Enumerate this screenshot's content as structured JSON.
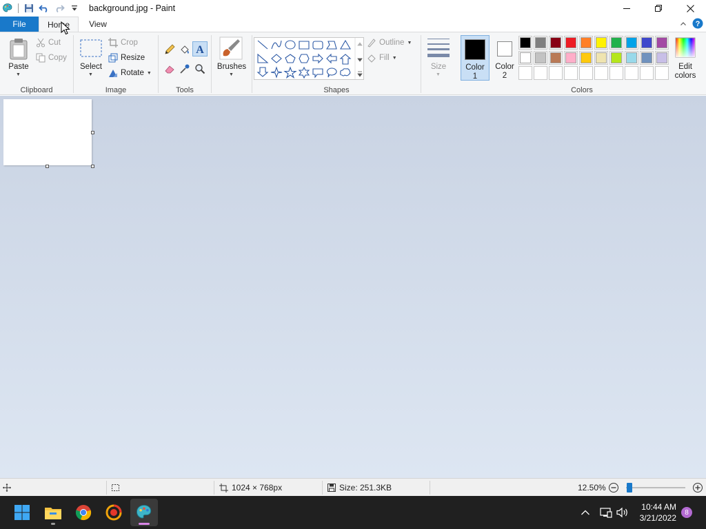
{
  "window": {
    "title": "background.jpg - Paint",
    "app_icon": "paint-palette-icon",
    "quick_access": [
      "save-icon",
      "undo-icon",
      "redo-icon",
      "customize-dropdown-icon"
    ],
    "controls": [
      "minimize-icon",
      "maximize-icon",
      "close-icon"
    ]
  },
  "tabs": {
    "file": "File",
    "home": "Home",
    "view": "View",
    "selected": "Home"
  },
  "ribbon": {
    "clipboard": {
      "label": "Clipboard",
      "paste": "Paste",
      "cut": "Cut",
      "copy": "Copy"
    },
    "image": {
      "label": "Image",
      "select": "Select",
      "crop": "Crop",
      "resize": "Resize",
      "rotate": "Rotate"
    },
    "tools": {
      "label": "Tools",
      "items": [
        "pencil-icon",
        "fill-bucket-icon",
        "text-icon",
        "eraser-icon",
        "color-picker-icon",
        "magnifier-icon"
      ]
    },
    "brushes": {
      "label": "Brushes"
    },
    "shapes": {
      "label": "Shapes",
      "outline": "Outline",
      "fill": "Fill"
    },
    "size": {
      "label": "Size"
    },
    "colors": {
      "label": "Colors",
      "color1": "Color\n1",
      "color1_line1": "Color",
      "color1_line2": "1",
      "color2_line1": "Color",
      "color2_line2": "2",
      "edit_line1": "Edit",
      "edit_line2": "colors",
      "color1_value": "#000000",
      "color2_value": "#ffffff",
      "palette_row1": [
        "#000000",
        "#7f7f7f",
        "#880015",
        "#ed1c24",
        "#ff7f27",
        "#fff200",
        "#22b14c",
        "#00a2e8",
        "#3f48cc",
        "#a349a4"
      ],
      "palette_row2": [
        "#ffffff",
        "#c3c3c3",
        "#b97a57",
        "#ffaec9",
        "#ffc90e",
        "#efe4b0",
        "#b5e61d",
        "#99d9ea",
        "#7092be",
        "#c8bfe7"
      ]
    }
  },
  "canvas": {
    "text": ""
  },
  "status": {
    "dimensions": "1024 × 768px",
    "size": "Size: 251.3KB",
    "zoom": "12.50%"
  },
  "taskbar": {
    "apps": [
      "windows-start-icon",
      "file-explorer-icon",
      "chrome-icon",
      "media-player-icon",
      "paint-icon"
    ],
    "time": "10:44 AM",
    "date": "3/21/2022",
    "notification_count": "8"
  },
  "accent": "#1979ca"
}
